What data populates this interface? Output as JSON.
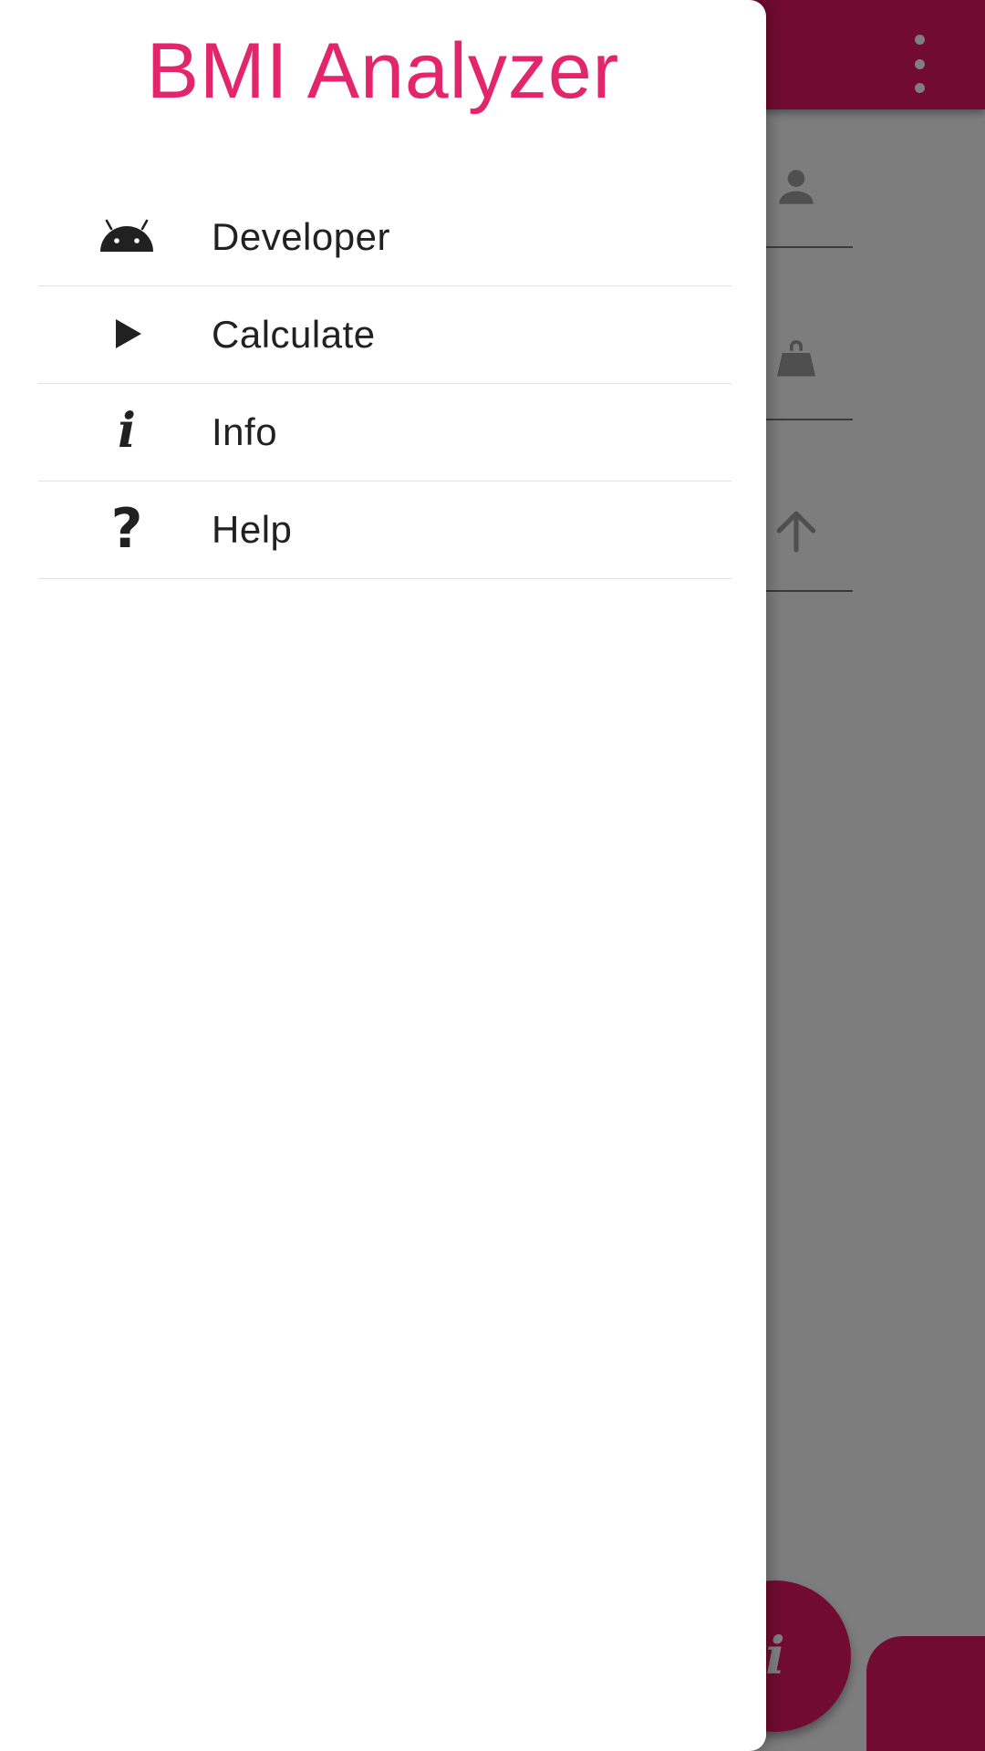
{
  "colors": {
    "accent": "#e3175f",
    "title_pink": "#e3266b",
    "icon_dark": "#212121",
    "scrim": "rgba(0,0,0,0.5)"
  },
  "background_screen": {
    "toolbar": {
      "overflow_icon": "more-vert-icon"
    },
    "fields": [
      {
        "icon": "person-icon"
      },
      {
        "icon": "weight-icon"
      },
      {
        "icon": "arrow-up-icon"
      }
    ],
    "fab": {
      "icon": "info-icon",
      "glyph": "i"
    }
  },
  "drawer": {
    "title": "BMI Analyzer",
    "menu": [
      {
        "label": "Developer",
        "icon": "android-icon"
      },
      {
        "label": "Calculate",
        "icon": "play-icon"
      },
      {
        "label": "Info",
        "icon": "info-icon",
        "glyph": "i"
      },
      {
        "label": "Help",
        "icon": "help-icon",
        "glyph": "?"
      }
    ]
  }
}
